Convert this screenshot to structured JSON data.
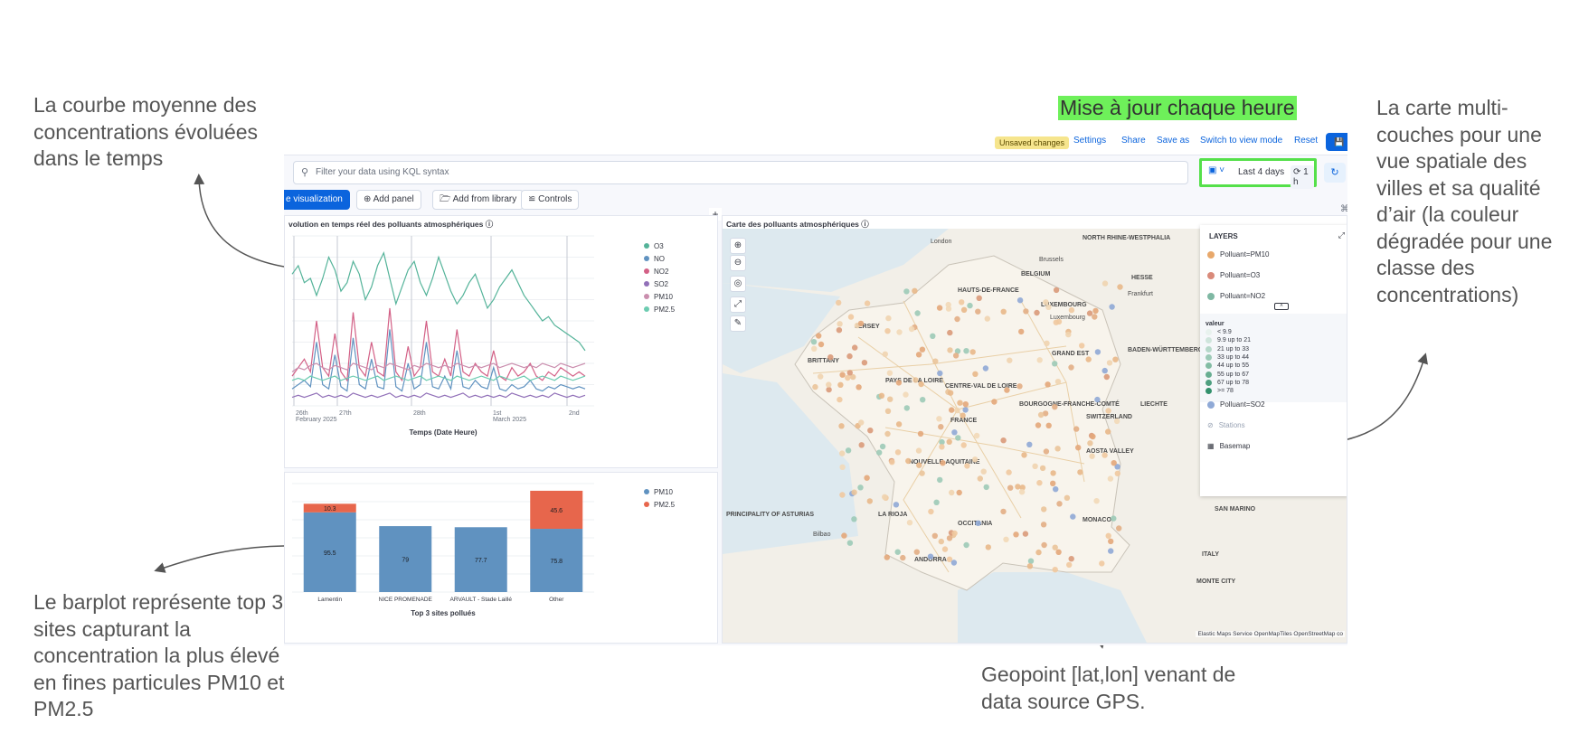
{
  "annotations": {
    "top_left": "La courbe moyenne des concentrations évoluées dans le temps",
    "bottom_left": "Le barplot représente top 3 sites capturant la concentration la plus élevé en fines particules PM10 et PM2.5",
    "right": "La carte multi-couches pour une vue spatiale des villes et sa qualité d’air (la couleur dégradée pour une classe des concentrations)",
    "bottom": "Geopoint [lat,lon] venant de data source GPS.",
    "highlight": "Mise à jour chaque heure"
  },
  "topbar": {
    "unsaved": "Unsaved changes",
    "settings": "Settings",
    "share": "Share",
    "save_as": "Save as",
    "switch_mode": "Switch to view mode",
    "reset": "Reset"
  },
  "query": {
    "placeholder": "Filter your data using KQL syntax",
    "time_range": "Last 4 days",
    "refresh_interval": "1 h"
  },
  "toolbar": {
    "create_viz": "e visualization",
    "add_panel": "Add panel",
    "add_library": "Add from library",
    "controls": "Controls"
  },
  "line_panel": {
    "title": "volution en temps réel des polluants atmosphériques",
    "xlabel": "Temps (Date Heure)",
    "ticks": [
      "26th\nFebruary 2025",
      "27th",
      "28th",
      "1st\nMarch 2025",
      "2nd"
    ]
  },
  "bar_panel": {
    "title": "Top 3 sites pollués"
  },
  "map_panel": {
    "title": "Carte des polluants atmosphériques",
    "layers_title": "LAYERS",
    "layers": [
      {
        "label": "Polluant=PM10",
        "color": "#e8a86b"
      },
      {
        "label": "Polluant=O3",
        "color": "#d98a7a"
      },
      {
        "label": "Polluant=NO2",
        "color": "#7fb8a3"
      }
    ],
    "valeur_title": "valeur",
    "valeur_classes": [
      {
        "label": "< 9.9",
        "color": "#e8f2ee"
      },
      {
        "label": "9.9 up to 21",
        "color": "#cfe5dc"
      },
      {
        "label": "21 up to 33",
        "color": "#b6d8ca"
      },
      {
        "label": "33 up to 44",
        "color": "#9ccab7"
      },
      {
        "label": "44 up to 55",
        "color": "#82bca4"
      },
      {
        "label": "55 up to 67",
        "color": "#68ae92"
      },
      {
        "label": "67 up to 78",
        "color": "#4e9f80"
      },
      {
        "label": ">= 78",
        "color": "#33916d"
      }
    ],
    "layer_so2": {
      "label": "Polluant=SO2",
      "color": "#8fa9d6"
    },
    "stations": "Stations",
    "basemap": "Basemap",
    "attribution": "Elastic Maps Service  OpenMapTiles  OpenStreetMap co",
    "places": [
      "London",
      "Brussels",
      "BELGIUM",
      "NORTH RHINE-WESTPHALIA",
      "HESSE",
      "Frankfurt",
      "LUXEMBOURG",
      "Luxembourg",
      "JERSEY",
      "HAUTS-DE-FRANCE",
      "GRAND EST",
      "BADEN-WÜRTTEMBERG",
      "BRITTANY",
      "PAYS DE LA LOIRE",
      "CENTRE-VAL DE LOIRE",
      "FRANCE",
      "BOURGOGNE-FRANCHE-COMTÉ",
      "SWITZERLAND",
      "LIECHTE",
      "AOSTA VALLEY",
      "NOUVELLE-AQUITAINE",
      "LA RIOJA",
      "OCCITANIA",
      "MONACO",
      "SAN MARINO",
      "PRINCIPALITY OF ASTURIAS",
      "Bilbao",
      "ANDORRA",
      "ITALY",
      "MONTE CITY"
    ]
  },
  "chart_data": [
    {
      "type": "line",
      "title": "volution en temps réel des polluants atmosphériques",
      "xlabel": "Temps (Date Heure)",
      "ylabel": "",
      "x_ticks": [
        "26th February 2025",
        "27th",
        "28th",
        "1st March 2025",
        "2nd"
      ],
      "series": [
        {
          "name": "O3",
          "color": "#54b399",
          "values": [
            62,
            66,
            58,
            60,
            52,
            60,
            70,
            64,
            54,
            58,
            68,
            62,
            50,
            56,
            66,
            72,
            60,
            48,
            56,
            64,
            68,
            58,
            52,
            60,
            70,
            62,
            54,
            48,
            52,
            58,
            62,
            54,
            46,
            50,
            56,
            60,
            64,
            58,
            52,
            48,
            44,
            40,
            42,
            38,
            36,
            34,
            32,
            30,
            26
          ]
        },
        {
          "name": "NO",
          "color": "#6092c0",
          "values": [
            8,
            10,
            12,
            9,
            30,
            10,
            8,
            24,
            9,
            7,
            32,
            10,
            8,
            22,
            9,
            8,
            36,
            9,
            7,
            20,
            8,
            10,
            30,
            9,
            8,
            14,
            8,
            26,
            9,
            8,
            12,
            9,
            8,
            18,
            8,
            7,
            10,
            8,
            9,
            12,
            8,
            7,
            9,
            8,
            10,
            9,
            8,
            9,
            8
          ]
        },
        {
          "name": "NO2",
          "color": "#d36086",
          "values": [
            14,
            18,
            22,
            16,
            40,
            18,
            14,
            34,
            16,
            12,
            44,
            18,
            14,
            30,
            16,
            14,
            46,
            16,
            12,
            28,
            14,
            18,
            40,
            16,
            14,
            22,
            14,
            36,
            16,
            14,
            20,
            16,
            14,
            26,
            14,
            12,
            18,
            14,
            16,
            20,
            14,
            12,
            16,
            14,
            18,
            16,
            14,
            16,
            14
          ]
        },
        {
          "name": "SO2",
          "color": "#9170b8",
          "values": [
            4,
            5,
            4,
            5,
            6,
            4,
            5,
            4,
            5,
            4,
            6,
            5,
            4,
            5,
            4,
            5,
            6,
            4,
            5,
            4,
            5,
            4,
            6,
            5,
            4,
            5,
            4,
            5,
            6,
            4,
            5,
            4,
            5,
            4,
            5,
            4,
            6,
            5,
            4,
            5,
            4,
            5,
            4,
            6,
            5,
            4,
            5,
            4,
            5
          ]
        },
        {
          "name": "PM10",
          "color": "#ca8eae",
          "values": [
            16,
            18,
            17,
            19,
            20,
            18,
            17,
            19,
            18,
            17,
            20,
            19,
            18,
            17,
            19,
            18,
            20,
            19,
            18,
            17,
            19,
            18,
            20,
            19,
            18,
            19,
            18,
            20,
            19,
            18,
            19,
            18,
            19,
            20,
            18,
            19,
            20,
            19,
            18,
            19,
            18,
            20,
            19,
            18,
            20,
            19,
            18,
            19,
            20
          ]
        },
        {
          "name": "PM2.5",
          "color": "#6dccb1",
          "values": [
            12,
            13,
            12,
            14,
            13,
            12,
            13,
            14,
            12,
            13,
            14,
            13,
            12,
            13,
            14,
            12,
            13,
            14,
            13,
            12,
            13,
            14,
            12,
            13,
            14,
            13,
            12,
            14,
            13,
            12,
            13,
            14,
            13,
            12,
            14,
            13,
            12,
            13,
            14,
            12,
            13,
            14,
            13,
            12,
            14,
            13,
            12,
            13,
            14
          ]
        }
      ],
      "legend": "right"
    },
    {
      "type": "bar",
      "title": "Top 3 sites pollués",
      "xlabel": "Top 3 sites pollués",
      "categories": [
        "Lamentin",
        "NICE PROMENADE",
        "ARVAULT - Stade Laillé",
        "Other"
      ],
      "series": [
        {
          "name": "PM10",
          "color": "#6092c0",
          "values": [
            95.5,
            79,
            77.7,
            75.8
          ]
        },
        {
          "name": "PM2.5",
          "color": "#e7664c",
          "values": [
            10.3,
            0,
            0,
            45.6
          ]
        }
      ],
      "stacked": true,
      "legend": "top-right"
    }
  ]
}
